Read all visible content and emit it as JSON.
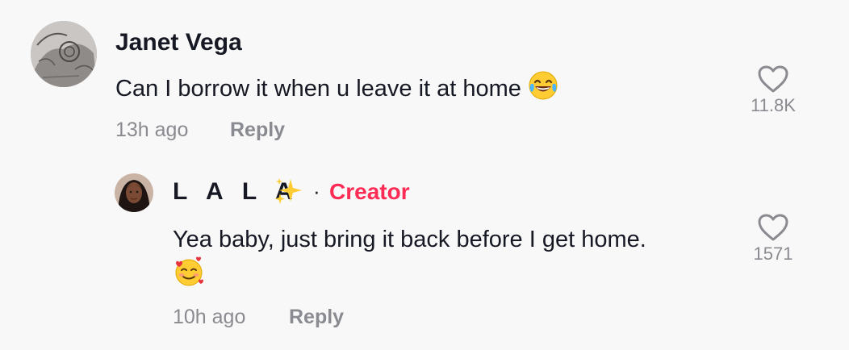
{
  "comments": [
    {
      "username": "Janet Vega",
      "text": "Can I borrow it when u leave it at home",
      "time": "13h ago",
      "reply_label": "Reply",
      "likes": "11.8K",
      "avatar_icon": "tattoo-sketch-avatar"
    }
  ],
  "reply": {
    "username": "L A L A",
    "username_emoji": "sparkles-icon",
    "separator": "·",
    "badge": "Creator",
    "text": "Yea baby, just bring it back before I get home.",
    "time": "10h ago",
    "reply_label": "Reply",
    "likes": "1571",
    "avatar_icon": "person-photo-avatar"
  },
  "colors": {
    "background": "#f8f8f8",
    "text": "#161823",
    "muted": "#8a8b91",
    "creator": "#fe2c55"
  }
}
